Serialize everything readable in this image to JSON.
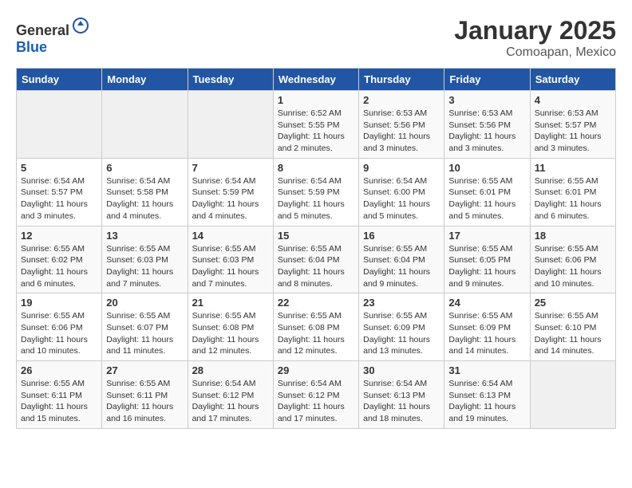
{
  "logo": {
    "text_general": "General",
    "text_blue": "Blue"
  },
  "header": {
    "month": "January 2025",
    "location": "Comoapan, Mexico"
  },
  "weekdays": [
    "Sunday",
    "Monday",
    "Tuesday",
    "Wednesday",
    "Thursday",
    "Friday",
    "Saturday"
  ],
  "weeks": [
    [
      {
        "day": "",
        "sunrise": "",
        "sunset": "",
        "daylight": ""
      },
      {
        "day": "",
        "sunrise": "",
        "sunset": "",
        "daylight": ""
      },
      {
        "day": "",
        "sunrise": "",
        "sunset": "",
        "daylight": ""
      },
      {
        "day": "1",
        "sunrise": "Sunrise: 6:52 AM",
        "sunset": "Sunset: 5:55 PM",
        "daylight": "Daylight: 11 hours and 2 minutes."
      },
      {
        "day": "2",
        "sunrise": "Sunrise: 6:53 AM",
        "sunset": "Sunset: 5:56 PM",
        "daylight": "Daylight: 11 hours and 3 minutes."
      },
      {
        "day": "3",
        "sunrise": "Sunrise: 6:53 AM",
        "sunset": "Sunset: 5:56 PM",
        "daylight": "Daylight: 11 hours and 3 minutes."
      },
      {
        "day": "4",
        "sunrise": "Sunrise: 6:53 AM",
        "sunset": "Sunset: 5:57 PM",
        "daylight": "Daylight: 11 hours and 3 minutes."
      }
    ],
    [
      {
        "day": "5",
        "sunrise": "Sunrise: 6:54 AM",
        "sunset": "Sunset: 5:57 PM",
        "daylight": "Daylight: 11 hours and 3 minutes."
      },
      {
        "day": "6",
        "sunrise": "Sunrise: 6:54 AM",
        "sunset": "Sunset: 5:58 PM",
        "daylight": "Daylight: 11 hours and 4 minutes."
      },
      {
        "day": "7",
        "sunrise": "Sunrise: 6:54 AM",
        "sunset": "Sunset: 5:59 PM",
        "daylight": "Daylight: 11 hours and 4 minutes."
      },
      {
        "day": "8",
        "sunrise": "Sunrise: 6:54 AM",
        "sunset": "Sunset: 5:59 PM",
        "daylight": "Daylight: 11 hours and 5 minutes."
      },
      {
        "day": "9",
        "sunrise": "Sunrise: 6:54 AM",
        "sunset": "Sunset: 6:00 PM",
        "daylight": "Daylight: 11 hours and 5 minutes."
      },
      {
        "day": "10",
        "sunrise": "Sunrise: 6:55 AM",
        "sunset": "Sunset: 6:01 PM",
        "daylight": "Daylight: 11 hours and 5 minutes."
      },
      {
        "day": "11",
        "sunrise": "Sunrise: 6:55 AM",
        "sunset": "Sunset: 6:01 PM",
        "daylight": "Daylight: 11 hours and 6 minutes."
      }
    ],
    [
      {
        "day": "12",
        "sunrise": "Sunrise: 6:55 AM",
        "sunset": "Sunset: 6:02 PM",
        "daylight": "Daylight: 11 hours and 6 minutes."
      },
      {
        "day": "13",
        "sunrise": "Sunrise: 6:55 AM",
        "sunset": "Sunset: 6:03 PM",
        "daylight": "Daylight: 11 hours and 7 minutes."
      },
      {
        "day": "14",
        "sunrise": "Sunrise: 6:55 AM",
        "sunset": "Sunset: 6:03 PM",
        "daylight": "Daylight: 11 hours and 7 minutes."
      },
      {
        "day": "15",
        "sunrise": "Sunrise: 6:55 AM",
        "sunset": "Sunset: 6:04 PM",
        "daylight": "Daylight: 11 hours and 8 minutes."
      },
      {
        "day": "16",
        "sunrise": "Sunrise: 6:55 AM",
        "sunset": "Sunset: 6:04 PM",
        "daylight": "Daylight: 11 hours and 9 minutes."
      },
      {
        "day": "17",
        "sunrise": "Sunrise: 6:55 AM",
        "sunset": "Sunset: 6:05 PM",
        "daylight": "Daylight: 11 hours and 9 minutes."
      },
      {
        "day": "18",
        "sunrise": "Sunrise: 6:55 AM",
        "sunset": "Sunset: 6:06 PM",
        "daylight": "Daylight: 11 hours and 10 minutes."
      }
    ],
    [
      {
        "day": "19",
        "sunrise": "Sunrise: 6:55 AM",
        "sunset": "Sunset: 6:06 PM",
        "daylight": "Daylight: 11 hours and 10 minutes."
      },
      {
        "day": "20",
        "sunrise": "Sunrise: 6:55 AM",
        "sunset": "Sunset: 6:07 PM",
        "daylight": "Daylight: 11 hours and 11 minutes."
      },
      {
        "day": "21",
        "sunrise": "Sunrise: 6:55 AM",
        "sunset": "Sunset: 6:08 PM",
        "daylight": "Daylight: 11 hours and 12 minutes."
      },
      {
        "day": "22",
        "sunrise": "Sunrise: 6:55 AM",
        "sunset": "Sunset: 6:08 PM",
        "daylight": "Daylight: 11 hours and 12 minutes."
      },
      {
        "day": "23",
        "sunrise": "Sunrise: 6:55 AM",
        "sunset": "Sunset: 6:09 PM",
        "daylight": "Daylight: 11 hours and 13 minutes."
      },
      {
        "day": "24",
        "sunrise": "Sunrise: 6:55 AM",
        "sunset": "Sunset: 6:09 PM",
        "daylight": "Daylight: 11 hours and 14 minutes."
      },
      {
        "day": "25",
        "sunrise": "Sunrise: 6:55 AM",
        "sunset": "Sunset: 6:10 PM",
        "daylight": "Daylight: 11 hours and 14 minutes."
      }
    ],
    [
      {
        "day": "26",
        "sunrise": "Sunrise: 6:55 AM",
        "sunset": "Sunset: 6:11 PM",
        "daylight": "Daylight: 11 hours and 15 minutes."
      },
      {
        "day": "27",
        "sunrise": "Sunrise: 6:55 AM",
        "sunset": "Sunset: 6:11 PM",
        "daylight": "Daylight: 11 hours and 16 minutes."
      },
      {
        "day": "28",
        "sunrise": "Sunrise: 6:54 AM",
        "sunset": "Sunset: 6:12 PM",
        "daylight": "Daylight: 11 hours and 17 minutes."
      },
      {
        "day": "29",
        "sunrise": "Sunrise: 6:54 AM",
        "sunset": "Sunset: 6:12 PM",
        "daylight": "Daylight: 11 hours and 17 minutes."
      },
      {
        "day": "30",
        "sunrise": "Sunrise: 6:54 AM",
        "sunset": "Sunset: 6:13 PM",
        "daylight": "Daylight: 11 hours and 18 minutes."
      },
      {
        "day": "31",
        "sunrise": "Sunrise: 6:54 AM",
        "sunset": "Sunset: 6:13 PM",
        "daylight": "Daylight: 11 hours and 19 minutes."
      },
      {
        "day": "",
        "sunrise": "",
        "sunset": "",
        "daylight": ""
      }
    ]
  ]
}
